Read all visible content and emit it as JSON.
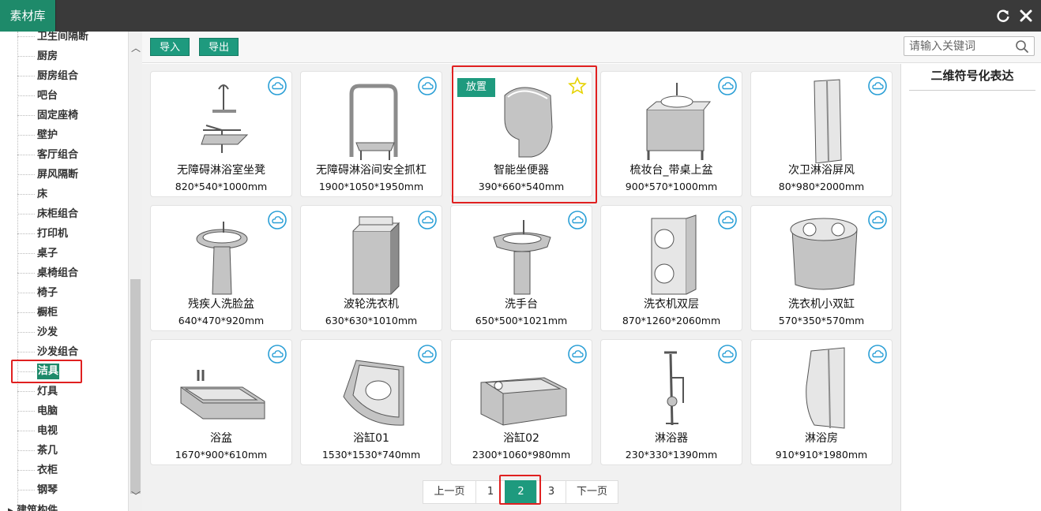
{
  "window": {
    "title": "素材库"
  },
  "sidebar": {
    "items": [
      "卫生间隔断",
      "厨房",
      "厨房组合",
      "吧台",
      "固定座椅",
      "壁护",
      "客厅组合",
      "屏风隔断",
      "床",
      "床柜组合",
      "打印机",
      "桌子",
      "桌椅组合",
      "椅子",
      "橱柜",
      "沙发",
      "沙发组合",
      "洁具",
      "灯具",
      "电脑",
      "电视",
      "茶几",
      "衣柜",
      "钢琴"
    ],
    "selected": "洁具",
    "parent_next": "建筑构件"
  },
  "toolbar": {
    "import_label": "导入",
    "export_label": "导出",
    "search_placeholder": "请输入关键词"
  },
  "items": [
    {
      "name": "无障碍淋浴室坐凳",
      "size": "820*540*1000mm",
      "icon": "shower-seat-icon"
    },
    {
      "name": "无障碍淋浴间安全抓杠",
      "size": "1900*1050*1950mm",
      "icon": "grab-bar-icon"
    },
    {
      "name": "智能坐便器",
      "size": "390*660*540mm",
      "icon": "toilet-icon"
    },
    {
      "name": "梳妆台_带桌上盆",
      "size": "900*570*1000mm",
      "icon": "vanity-icon"
    },
    {
      "name": "次卫淋浴屏风",
      "size": "80*980*2000mm",
      "icon": "shower-screen-icon"
    },
    {
      "name": "残疾人洗脸盆",
      "size": "640*470*920mm",
      "icon": "pedestal-basin-icon"
    },
    {
      "name": "波轮洗衣机",
      "size": "630*630*1010mm",
      "icon": "washer-icon"
    },
    {
      "name": "洗手台",
      "size": "650*500*1021mm",
      "icon": "wash-basin-icon"
    },
    {
      "name": "洗衣机双层",
      "size": "870*1260*2060mm",
      "icon": "double-washer-icon"
    },
    {
      "name": "洗衣机小双缸",
      "size": "570*350*570mm",
      "icon": "twin-tub-icon"
    },
    {
      "name": "浴盆",
      "size": "1670*900*610mm",
      "icon": "bathtub-icon"
    },
    {
      "name": "浴缸01",
      "size": "1530*1530*740mm",
      "icon": "corner-tub-icon"
    },
    {
      "name": "浴缸02",
      "size": "2300*1060*980mm",
      "icon": "jacuzzi-icon"
    },
    {
      "name": "淋浴器",
      "size": "230*330*1390mm",
      "icon": "shower-head-icon"
    },
    {
      "name": "淋浴房",
      "size": "910*910*1980mm",
      "icon": "shower-room-icon"
    }
  ],
  "hovered": {
    "place_label": "放置"
  },
  "pagination": {
    "prev": "上一页",
    "pages": [
      "1",
      "2",
      "3"
    ],
    "current": "2",
    "next": "下一页"
  },
  "right_panel": {
    "title": "二维符号化表达"
  },
  "colors": {
    "accent": "#1e9a7e",
    "highlight": "#e02020",
    "titlebar": "#3a3a3a"
  }
}
